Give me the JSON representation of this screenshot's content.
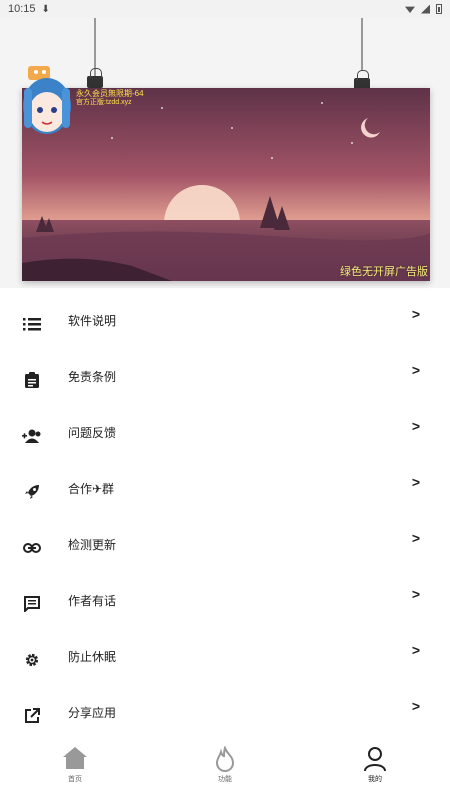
{
  "status_bar": {
    "time": "10:15",
    "download_glyph": "⬇"
  },
  "banner": {
    "line1": "永久会员無限期-64",
    "line2": "官方正版:tzdd.xyz",
    "caption": "绿色无开屏广告版"
  },
  "menu": {
    "items": [
      {
        "label": "软件说明",
        "icon": "list-icon"
      },
      {
        "label": "免责条例",
        "icon": "clipboard-icon"
      },
      {
        "label": "问题反馈",
        "icon": "people-add-icon"
      },
      {
        "label": "合作✈群",
        "icon": "rocket-icon"
      },
      {
        "label": "检测更新",
        "icon": "link-icon"
      },
      {
        "label": "作者有话",
        "icon": "message-icon"
      },
      {
        "label": "防止休眠",
        "icon": "gear-icon"
      },
      {
        "label": "分享应用",
        "icon": "share-icon"
      }
    ],
    "arrow": ">"
  },
  "bottom_nav": {
    "tabs": [
      {
        "label": "首页",
        "icon": "home-icon"
      },
      {
        "label": "功能",
        "icon": "flame-icon"
      },
      {
        "label": "我的",
        "icon": "profile-icon"
      }
    ]
  }
}
